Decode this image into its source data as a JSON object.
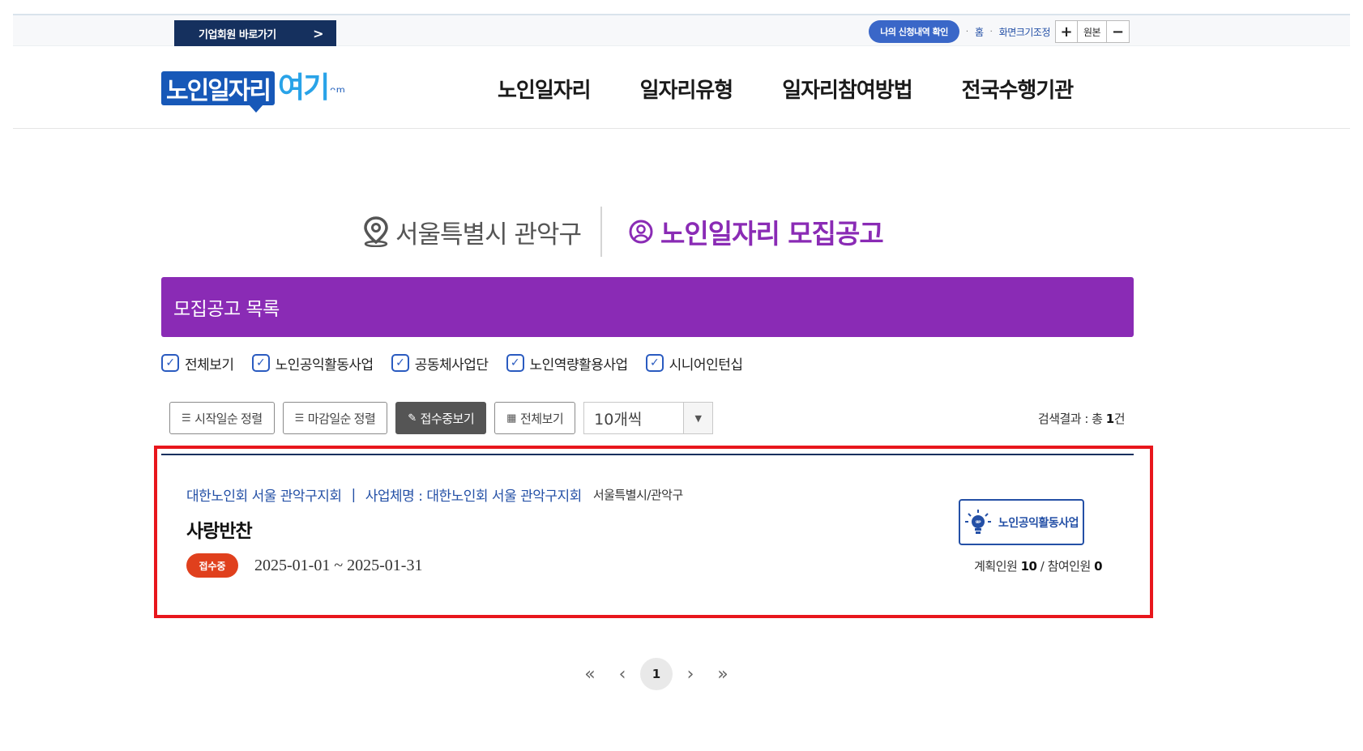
{
  "topbar": {
    "corp_member": "기업회원 바로가기",
    "corp_chevron": ">",
    "my_apply": "나의 신청내역 확인",
    "home": "홈",
    "screen_size": "화면크기조정",
    "zoom_in": "+",
    "zoom_original": "원본",
    "zoom_out": "−"
  },
  "header": {
    "logo_main": "노인일자리",
    "logo_accent": "여기",
    "logo_mark": "ᵔᵐ",
    "nav": [
      "노인일자리",
      "일자리유형",
      "일자리참여방법",
      "전국수행기관"
    ]
  },
  "title": {
    "location": "서울특별시 관악구",
    "heading": "노인일자리 모집공고"
  },
  "list_header": "모집공고 목록",
  "filters": [
    {
      "label": "전체보기",
      "checked": true
    },
    {
      "label": "노인공익활동사업",
      "checked": true
    },
    {
      "label": "공동체사업단",
      "checked": true
    },
    {
      "label": "노인역량활용사업",
      "checked": true
    },
    {
      "label": "시니어인턴십",
      "checked": true
    }
  ],
  "toolbar": {
    "sort_start": "시작일순 정렬",
    "sort_deadline": "마감일순 정렬",
    "view_open": "접수중보기",
    "view_all": "전체보기",
    "page_size": "10개씩",
    "result_prefix": "검색결과 : 총 ",
    "result_count": "1",
    "result_suffix": "건"
  },
  "results": [
    {
      "org": "대한노인회 서울 관악구지회",
      "sep": "|",
      "business_label": "사업체명 : 대한노인회 서울 관악구지회",
      "region": "서울특별시/관악구",
      "title": "사랑반찬",
      "status": "접수중",
      "period": "2025-01-01 ~ 2025-01-31",
      "type": "노인공익활동사업",
      "planned_label": "계획인원",
      "planned": "10",
      "slash": " / ",
      "joined_label": "참여인원",
      "joined": "0"
    }
  ],
  "pagination": {
    "first": "«",
    "prev": "‹",
    "current": "1",
    "next": "›",
    "last": "»"
  },
  "colors": {
    "purple": "#8a2bb5",
    "navy": "#15305e",
    "blue": "#2450a6",
    "badge_orange": "#e0401d",
    "highlight_red": "#e8161c"
  }
}
